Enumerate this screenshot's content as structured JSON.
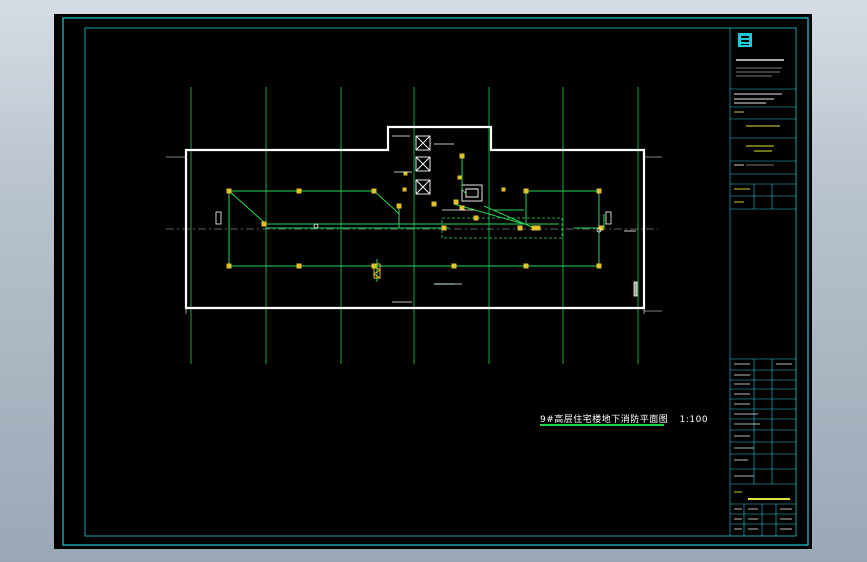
{
  "drawing": {
    "plan_title": "9#高层住宅楼地下消防平面图",
    "scale": "1:100"
  },
  "colors": {
    "sheet_background": "#000000",
    "frame_lines": "#1ec8d8",
    "walls": "#ffffff",
    "axis_lines": "#19d34a",
    "pipes": "#2bd45a",
    "equipment": "#e0c12a",
    "page_background": "#b9c3ce"
  },
  "title_block": {
    "logo_icon": "company-logo-icon"
  }
}
